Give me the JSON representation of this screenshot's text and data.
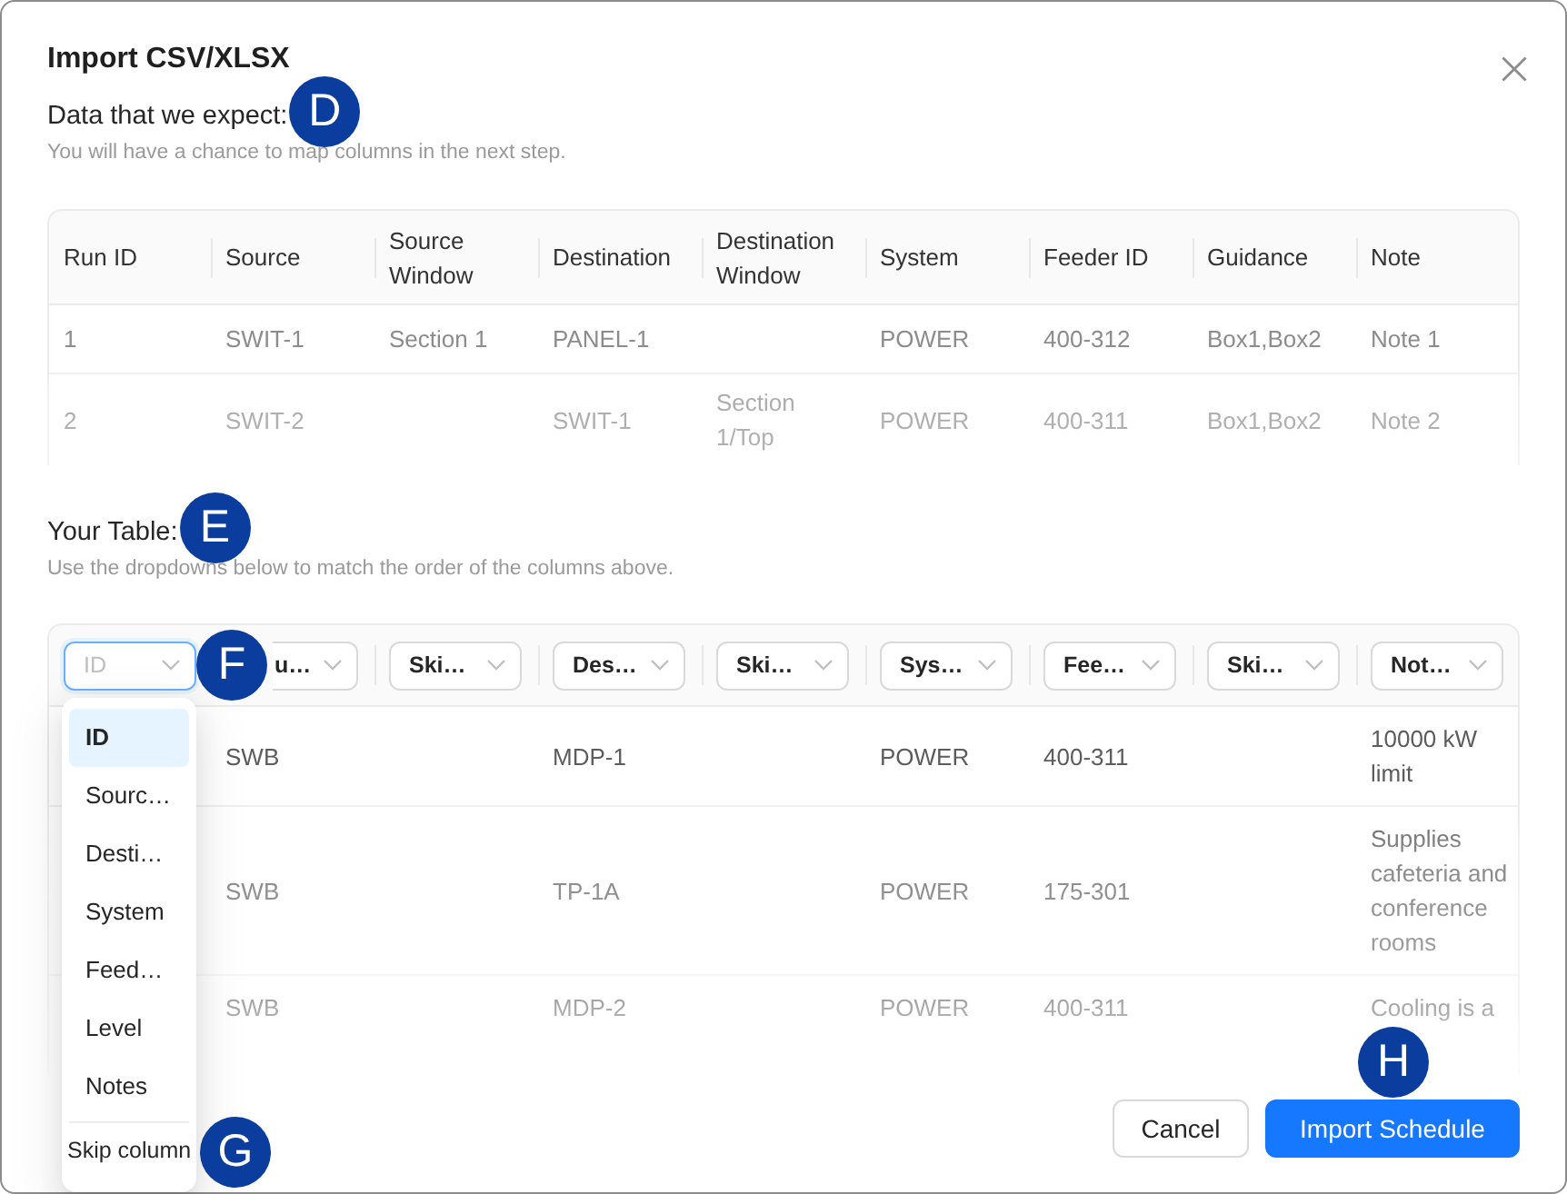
{
  "dialog": {
    "title": "Import CSV/XLSX"
  },
  "expected_section": {
    "heading": "Data that we expect:",
    "marker": "D",
    "hint": "You will have a chance to map columns in the next step."
  },
  "expected_table": {
    "columns": [
      "Run ID",
      "Source",
      "Source Window",
      "Destination",
      "Destination Window",
      "System",
      "Feeder ID",
      "Guidance",
      "Note"
    ],
    "rows": [
      {
        "column_1": "1",
        "column_2": "SWIT-1",
        "column_3": "Section 1",
        "column_4": "PANEL-1",
        "column_6": "POWER",
        "column_7": "400-312",
        "column_8": "Box1,Box2",
        "column_9": "Note 1"
      },
      {
        "column_1": "2",
        "column_2": "SWIT-2",
        "column_4": "SWIT-1",
        "column_5": "Section 1/Top",
        "column_6": "POWER",
        "column_7": "400-311",
        "column_8": "Box1,Box2",
        "column_9": "Note 2"
      }
    ]
  },
  "your_table_section": {
    "heading": "Your Table:",
    "marker": "E",
    "hint": "Use the dropdowns below to match the order of the columns above."
  },
  "column_mappings": [
    {
      "placeholder": "ID",
      "open": true,
      "marker": "F"
    },
    {
      "value": "u…",
      "open": false
    },
    {
      "value": "Ski…",
      "open": false
    },
    {
      "value": "Des…",
      "open": false
    },
    {
      "value": "Ski…",
      "open": false
    },
    {
      "value": "Sys…",
      "open": false
    },
    {
      "value": "Fee…",
      "open": false
    },
    {
      "value": "Ski…",
      "open": false
    },
    {
      "value": "Not…",
      "open": false
    }
  ],
  "dropdown_menu": {
    "items": [
      {
        "label": "ID",
        "selected": true
      },
      {
        "label": "Sourc…",
        "selected": false
      },
      {
        "label": "Desti…",
        "selected": false
      },
      {
        "label": "System",
        "selected": false
      },
      {
        "label": "Feed…",
        "selected": false
      },
      {
        "label": "Level",
        "selected": false
      },
      {
        "label": "Notes",
        "selected": false
      }
    ],
    "footer_item": {
      "label": "Skip column",
      "marker": "G"
    }
  },
  "your_table": {
    "rows": [
      {
        "column_2": "SWB",
        "column_4": "MDP-1",
        "column_6": "POWER",
        "column_7": "400-311",
        "column_9": "10000 kW limit"
      },
      {
        "column_2": "SWB",
        "column_4": "TP-1A",
        "column_6": "POWER",
        "column_7": "175-301",
        "column_9": "Supplies cafeteria and conference rooms"
      },
      {
        "column_2": "SWB",
        "column_4": "MDP-2",
        "column_6": "POWER",
        "column_7": "400-311",
        "column_9": "Cooling is a"
      }
    ]
  },
  "buttons": [
    {
      "label": "Cancel",
      "kind": "cancel"
    },
    {
      "label": "Import Schedule",
      "kind": "submit",
      "marker": "H"
    }
  ]
}
